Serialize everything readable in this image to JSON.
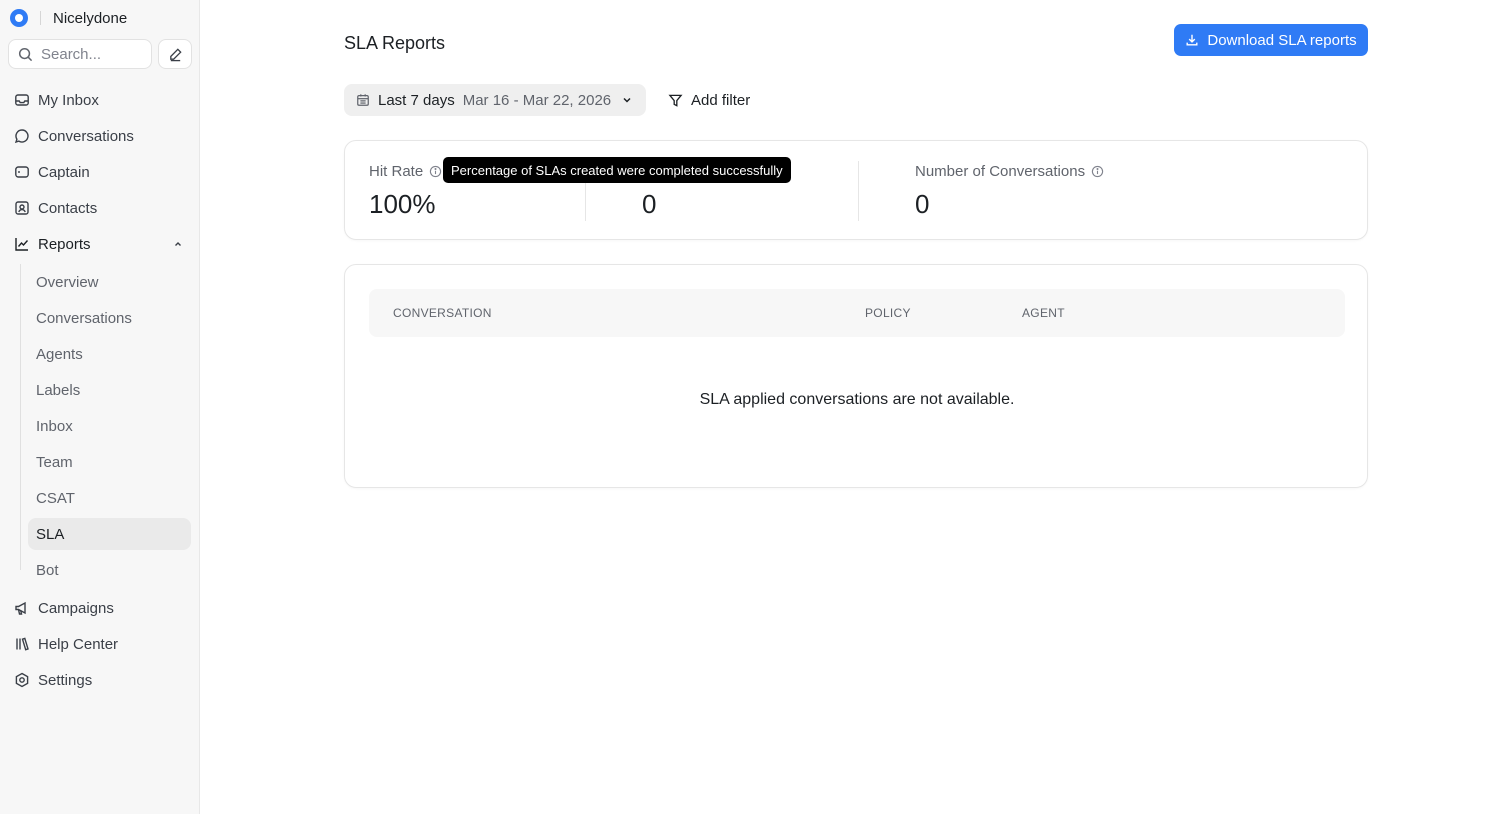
{
  "sidebar": {
    "brand_name": "Nicelydone",
    "search_placeholder": "Search...",
    "nav": [
      {
        "label": "My Inbox",
        "icon": "inbox-icon"
      },
      {
        "label": "Conversations",
        "icon": "chat-bubble-icon"
      },
      {
        "label": "Captain",
        "icon": "captain-icon"
      },
      {
        "label": "Contacts",
        "icon": "contact-card-icon"
      },
      {
        "label": "Reports",
        "icon": "line-chart-icon"
      },
      {
        "label": "Campaigns",
        "icon": "megaphone-icon"
      },
      {
        "label": "Help Center",
        "icon": "library-icon"
      },
      {
        "label": "Settings",
        "icon": "gear-icon"
      }
    ],
    "reports_sub": [
      "Overview",
      "Conversations",
      "Agents",
      "Labels",
      "Inbox",
      "Team",
      "CSAT",
      "SLA",
      "Bot"
    ],
    "active_sub": "SLA"
  },
  "header": {
    "title": "SLA Reports",
    "download_label": "Download SLA reports"
  },
  "filters": {
    "range_label": "Last 7 days",
    "range_dates": "Mar 16 - Mar 22, 2026",
    "add_filter_label": "Add filter"
  },
  "metrics": [
    {
      "label": "Hit Rate",
      "value": "100%"
    },
    {
      "label": "",
      "value": "0"
    },
    {
      "label": "Number of Conversations",
      "value": "0"
    }
  ],
  "tooltip": "Percentage of SLAs created were completed successfully",
  "table": {
    "columns": [
      "CONVERSATION",
      "POLICY",
      "AGENT"
    ],
    "empty_message": "SLA applied conversations are not available."
  },
  "colors": {
    "accent": "#2f7bf5",
    "sidebar_bg": "#f7f7f7",
    "active_item_bg": "#eaeaea"
  }
}
